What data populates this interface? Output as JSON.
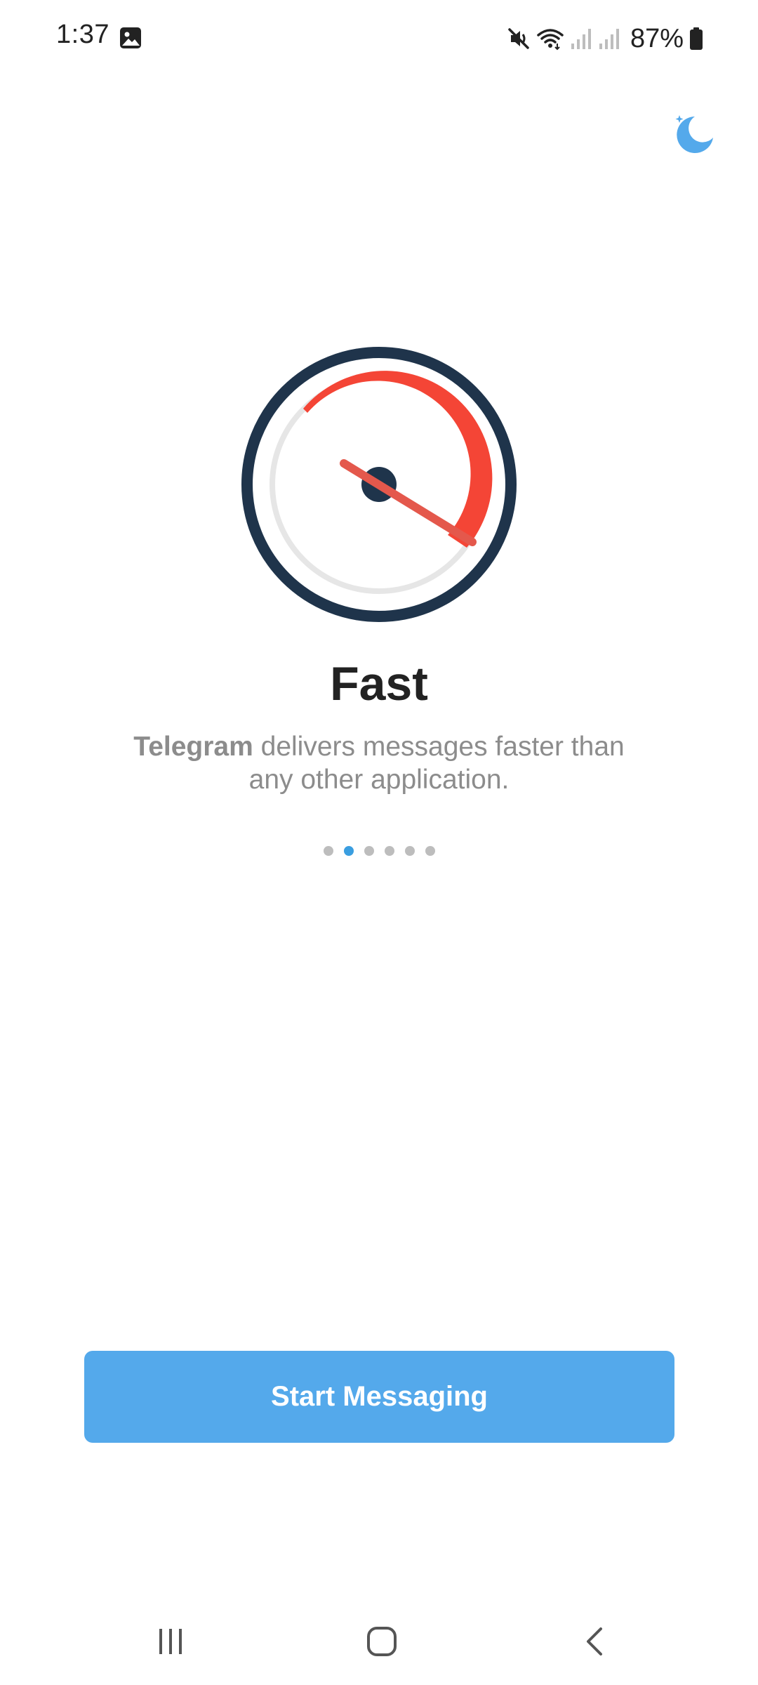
{
  "status_bar": {
    "time": "1:37",
    "battery_percent": "87%",
    "icons": [
      "gallery-icon",
      "mute-icon",
      "wifi-icon",
      "signal-icon",
      "signal-icon",
      "battery-icon"
    ]
  },
  "night_mode_icon": "moon-icon",
  "illustration": "speedometer",
  "title": "Fast",
  "description": {
    "brand": "Telegram",
    "text": " delivers messages faster than any other application."
  },
  "page_indicator": {
    "count": 6,
    "active_index": 1
  },
  "start_button": {
    "label": "Start Messaging"
  },
  "nav_bar": {
    "icons": [
      "recents-icon",
      "home-icon",
      "back-icon"
    ]
  },
  "colors": {
    "accent": "#54a9eb",
    "dot_active": "#3a9ee0",
    "dot_inactive": "#bdbdbd",
    "gauge_ring": "#1f344b",
    "gauge_arc": "#f44536",
    "text_primary": "#222222",
    "text_secondary": "#8c8c8c"
  }
}
